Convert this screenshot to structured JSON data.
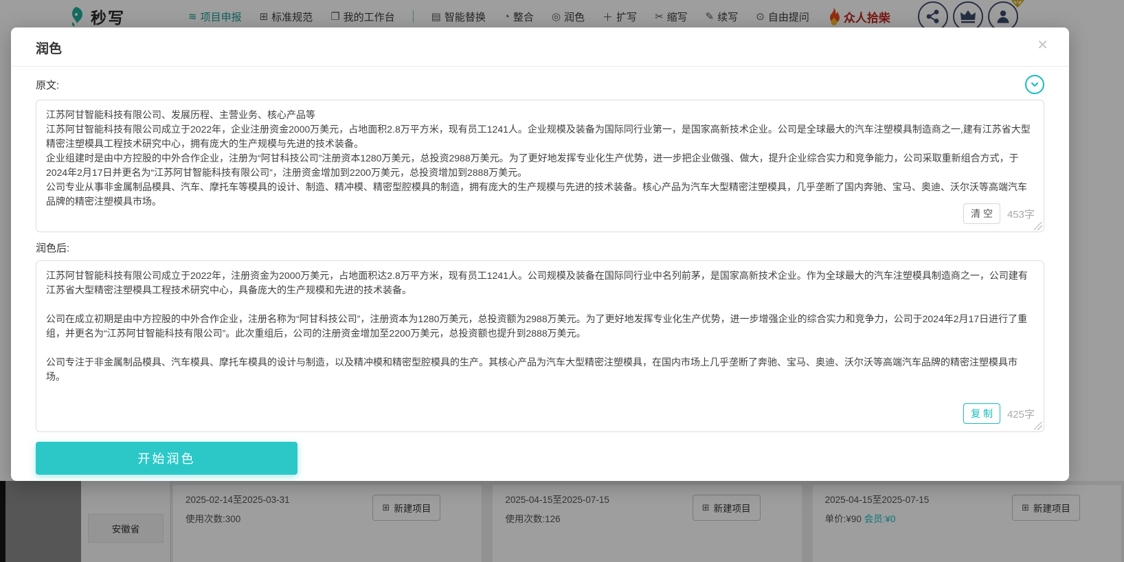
{
  "colors": {
    "accent_teal": "#17bdbd",
    "button_teal": "#2cc8c8",
    "nav_active_teal": "#1b9d97",
    "promo_red": "#c4261d",
    "icon_navy": "#3d4d6e"
  },
  "icons": {
    "layers": "≋",
    "grid": "⊞",
    "folder": "❐",
    "replace": "▤",
    "merge": "◔",
    "polish": "◎",
    "expand": "＋",
    "shrink": "✂",
    "continue": "✎",
    "chat": "⊙",
    "close": "✕",
    "add": "⊞"
  },
  "nav": {
    "brand": "秒写",
    "items": [
      {
        "label": "项目申报"
      },
      {
        "label": "标准规范"
      },
      {
        "label": "我的工作台"
      },
      {
        "label": "智能替换"
      },
      {
        "label": "整合"
      },
      {
        "label": "润色"
      },
      {
        "label": "扩写"
      },
      {
        "label": "缩写"
      },
      {
        "label": "续写"
      },
      {
        "label": "自由提问"
      }
    ],
    "promo": "众人拾柴"
  },
  "modal": {
    "title": "润色",
    "source": {
      "label": "原文:",
      "text": "江苏阿甘智能科技有限公司、发展历程、主营业务、核心产品等\n江苏阿甘智能科技有限公司成立于2022年，企业注册资金2000万美元，占地面积2.8万平方米，现有员工1241人。企业规模及装备为国际同行业第一，是国家高新技术企业。公司是全球最大的汽车注塑模具制造商之一,建有江苏省大型精密注塑模具工程技术研究中心，拥有庞大的生产规模与先进的技术装备。\n企业组建时是由中方控股的中外合作企业，注册为“阿甘科技公司”注册资本1280万美元，总投资2988万美元。为了更好地发挥专业化生产优势，进一步把企业做强、做大，提升企业综合实力和竞争能力，公司采取重新组合方式，于2024年2月17日并更名为“江苏阿甘智能科技有限公司”，注册资金增加到2200万美元，总投资增加到2888万美元。\n公司专业从事非金属制品模具、汽车、摩托车等模具的设计、制造、精冲模、精密型腔模具的制造，拥有庞大的生产规模与先进的技术装备。核心产品为汽车大型精密注塑模具，几乎垄断了国内奔驰、宝马、奥迪、沃尔沃等高端汽车品牌的精密注塑模具市场。",
      "clear_button": "清 空",
      "char_count": "453字"
    },
    "result": {
      "label": "润色后:",
      "text": "江苏阿甘智能科技有限公司成立于2022年，注册资金为2000万美元，占地面积达2.8万平方米，现有员工1241人。公司规模及装备在国际同行业中名列前茅，是国家高新技术企业。作为全球最大的汽车注塑模具制造商之一，公司建有江苏省大型精密注塑模具工程技术研究中心，具备庞大的生产规模和先进的技术装备。\n\n公司在成立初期是由中方控股的中外合作企业，注册名称为“阿甘科技公司”，注册资本为1280万美元，总投资额为2988万美元。为了更好地发挥专业化生产优势，进一步增强企业的综合实力和竞争力，公司于2024年2月17日进行了重组，并更名为“江苏阿甘智能科技有限公司”。此次重组后，公司的注册资金增加至2200万美元，总投资额也提升到2888万美元。\n\n公司专注于非金属制品模具、汽车模具、摩托车模具的设计与制造，以及精冲模和精密型腔模具的生产。其核心产品为汽车大型精密注塑模具，在国内市场上几乎垄断了奔驰、宝马、奥迪、沃尔沃等高端汽车品牌的精密注塑模具市场。",
      "copy_button": "复 制",
      "char_count": "425字"
    },
    "submit_button": "开始润色"
  },
  "background": {
    "province": "安徽省",
    "cards": [
      {
        "date_range": "2025-02-14至2025-03-31",
        "info": "使用次数:300",
        "button": "新建项目"
      },
      {
        "date_range": "2025-04-15至2025-07-15",
        "info": "使用次数:126",
        "button": "新建项目"
      },
      {
        "date_range": "2025-04-15至2025-07-15",
        "price": "单价:¥90",
        "member": "会员:¥0",
        "button": "新建项目"
      }
    ]
  }
}
